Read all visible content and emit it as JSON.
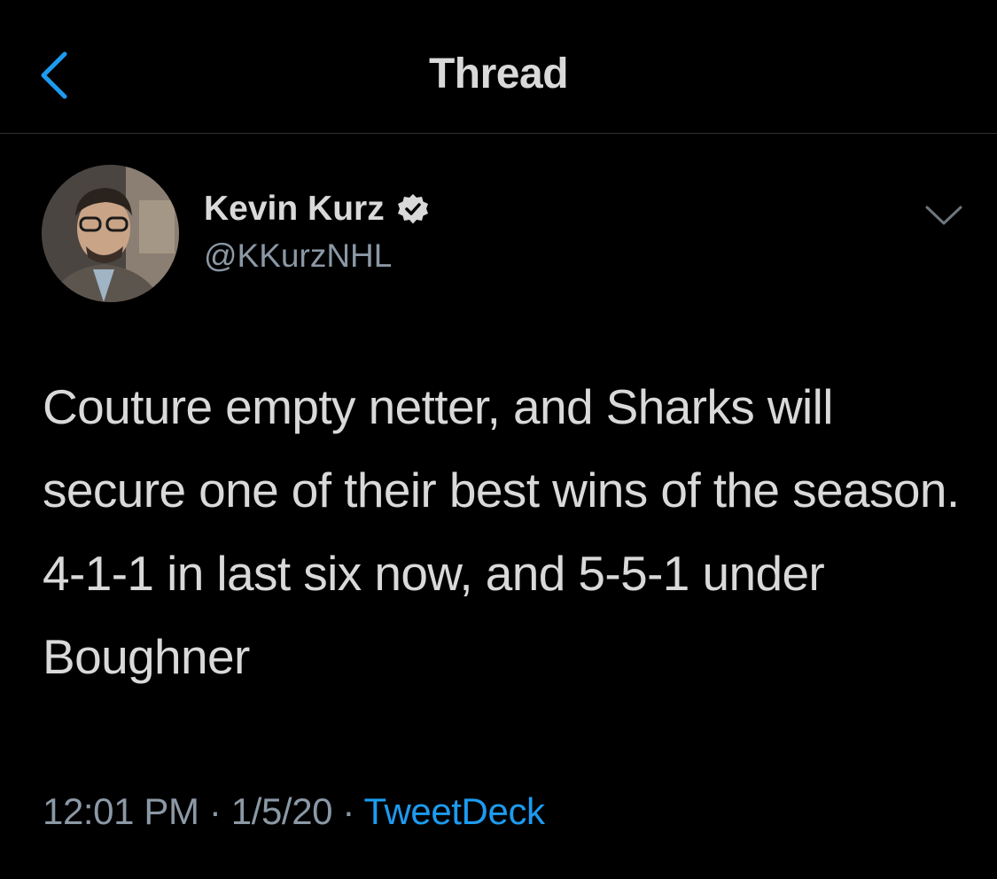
{
  "header": {
    "title": "Thread",
    "back_icon": "chevron-left-icon"
  },
  "tweet": {
    "author": {
      "display_name": "Kevin Kurz",
      "handle": "@KKurzNHL",
      "verified": true
    },
    "text": "Couture empty netter, and Sharks will secure one of their best wins of the season. 4-1-1 in last six now, and 5-5-1 under Boughner",
    "time": "12:01 PM",
    "separator": "·",
    "date": "1/5/20",
    "source": "TweetDeck"
  },
  "colors": {
    "background": "#000000",
    "text": "#d9d9d9",
    "secondary_text": "#8b98a5",
    "accent": "#1d9bf0",
    "divider": "#2f3336"
  }
}
